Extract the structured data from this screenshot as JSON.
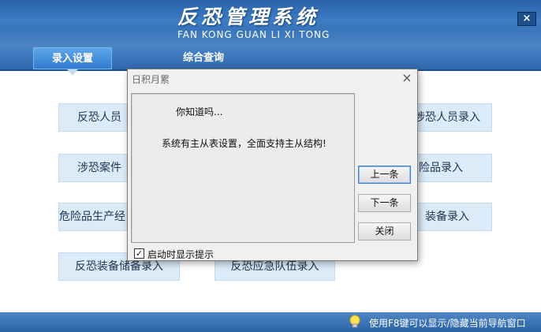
{
  "header": {
    "title_cn": "反恐管理系统",
    "title_en": "FAN KONG GUAN LI XI TONG",
    "close_label": "×"
  },
  "tabs": [
    {
      "label": "录入设置"
    },
    {
      "label": "综合查询"
    }
  ],
  "menu": {
    "left": [
      {
        "label": "反恐人员"
      },
      {
        "label": "涉恐案件"
      },
      {
        "label": "危险品生产经"
      },
      {
        "label": "反恐装备储备录入"
      }
    ],
    "right": [
      {
        "label": "涉恐人员录入"
      },
      {
        "label": "险品录入"
      },
      {
        "label": "装备录入"
      }
    ],
    "bottom_center": {
      "label": "反恐应急队伍录入"
    }
  },
  "dialog": {
    "title": "日积月累",
    "close_label": "×",
    "heading": "你知道吗...",
    "tip": "系统有主从表设置，全面支持主从结构!",
    "buttons": {
      "prev": "上一条",
      "next": "下一条",
      "close": "关闭"
    },
    "checkbox_label": "启动时显示提示",
    "checkbox_checked": true,
    "checkbox_mark": "✓"
  },
  "footer": {
    "hint": "使用F8键可以显示/隐藏当前导航窗口"
  },
  "colors": {
    "header_blue": "#2a64ab",
    "button_bg": "#dcebf8",
    "dialog_bg": "#f0f0f0"
  }
}
